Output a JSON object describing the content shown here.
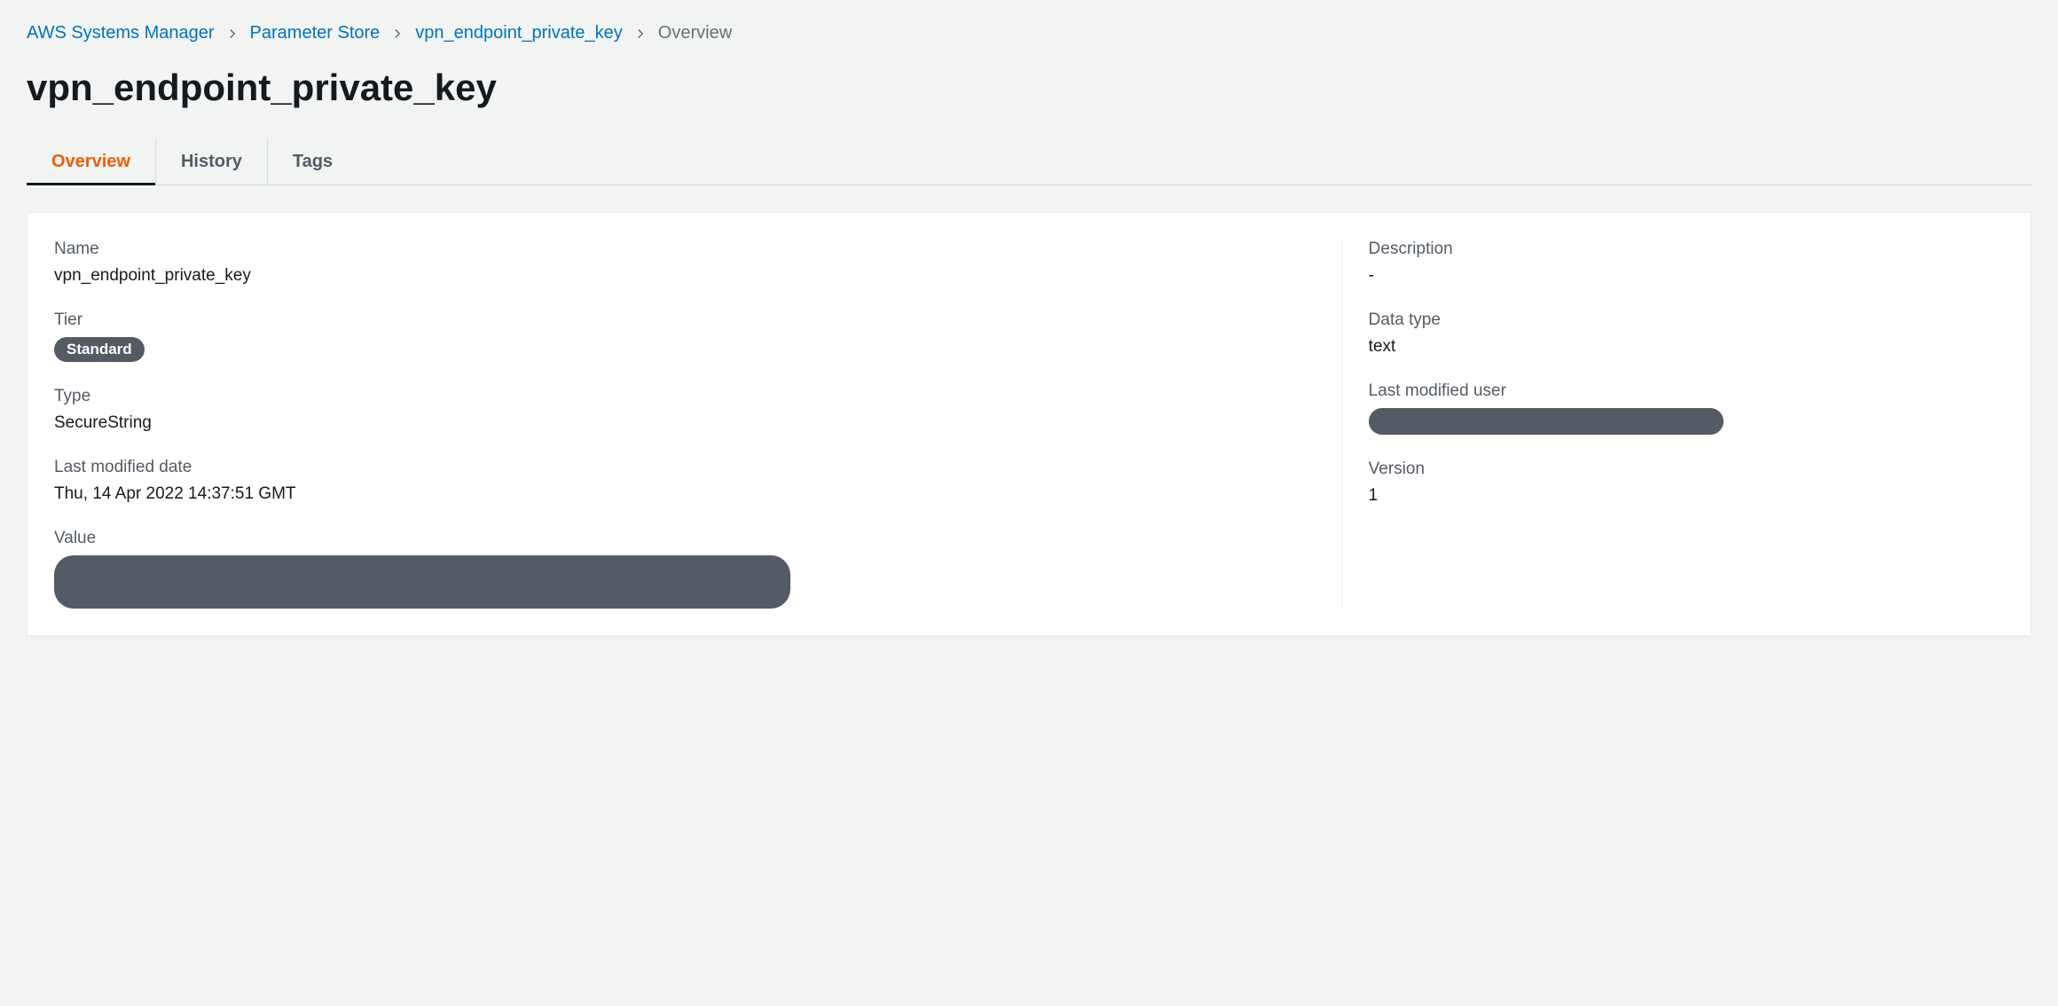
{
  "breadcrumb": {
    "items": [
      {
        "label": "AWS Systems Manager",
        "link": true
      },
      {
        "label": "Parameter Store",
        "link": true
      },
      {
        "label": "vpn_endpoint_private_key",
        "link": true
      },
      {
        "label": "Overview",
        "link": false
      }
    ]
  },
  "page_title": "vpn_endpoint_private_key",
  "tabs": [
    {
      "label": "Overview",
      "active": true
    },
    {
      "label": "History",
      "active": false
    },
    {
      "label": "Tags",
      "active": false
    }
  ],
  "details": {
    "name_label": "Name",
    "name_value": "vpn_endpoint_private_key",
    "tier_label": "Tier",
    "tier_value": "Standard",
    "type_label": "Type",
    "type_value": "SecureString",
    "last_modified_date_label": "Last modified date",
    "last_modified_date_value": "Thu, 14 Apr 2022 14:37:51 GMT",
    "value_label": "Value",
    "description_label": "Description",
    "description_value": "-",
    "data_type_label": "Data type",
    "data_type_value": "text",
    "last_modified_user_label": "Last modified user",
    "version_label": "Version",
    "version_value": "1"
  }
}
